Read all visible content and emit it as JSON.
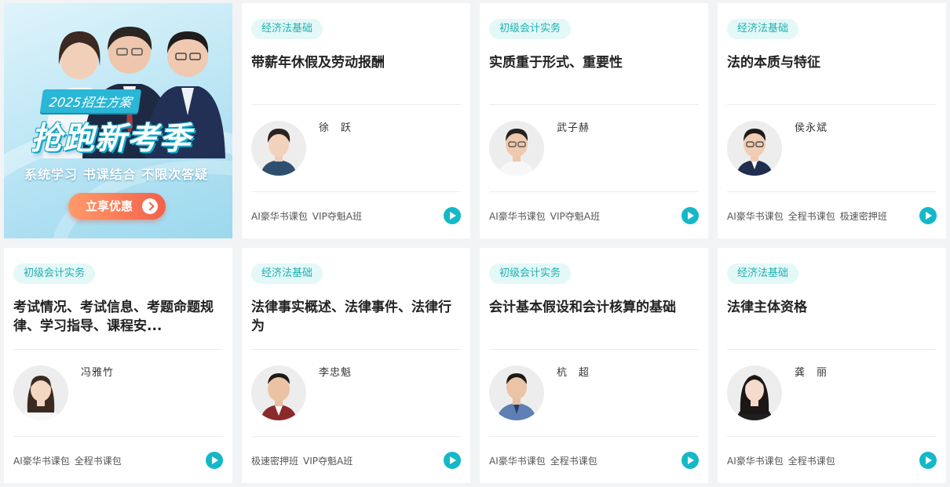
{
  "banner": {
    "tag": "2025招生方案",
    "headline": "抢跑新考季",
    "subtitle": "系统学习  书课结合  不限次答疑",
    "button": "立享优惠"
  },
  "cards": [
    {
      "tag": "经济法基础",
      "title": "带薪年休假及劳动报酬",
      "teacher": "徐　跃",
      "courses": [
        "AI豪华书课包",
        "VIP夺魁A班"
      ]
    },
    {
      "tag": "初级会计实务",
      "title": "实质重于形式、重要性",
      "teacher": "武子赫",
      "courses": [
        "AI豪华书课包",
        "VIP夺魁A班"
      ]
    },
    {
      "tag": "经济法基础",
      "title": "法的本质与特征",
      "teacher": "侯永斌",
      "courses": [
        "AI豪华书课包",
        "全程书课包",
        "极速密押班"
      ]
    },
    {
      "tag": "初级会计实务",
      "title": "考试情况、考试信息、考题命题规律、学习指导、课程安...",
      "teacher": "冯雅竹",
      "courses": [
        "AI豪华书课包",
        "全程书课包"
      ]
    },
    {
      "tag": "经济法基础",
      "title": "法律事实概述、法律事件、法律行为",
      "teacher": "李忠魁",
      "courses": [
        "极速密押班",
        "VIP夺魁A班"
      ]
    },
    {
      "tag": "初级会计实务",
      "title": "会计基本假设和会计核算的基础",
      "teacher": "杭　超",
      "courses": [
        "AI豪华书课包",
        "全程书课包"
      ]
    },
    {
      "tag": "经济法基础",
      "title": "法律主体资格",
      "teacher": "龚　丽",
      "courses": [
        "AI豪华书课包",
        "全程书课包"
      ]
    }
  ],
  "colors": {
    "accent": "#14b8c8",
    "tag_bg": "#e3f8f7",
    "tag_text": "#1eb0b3",
    "cta": "#f2614a"
  }
}
